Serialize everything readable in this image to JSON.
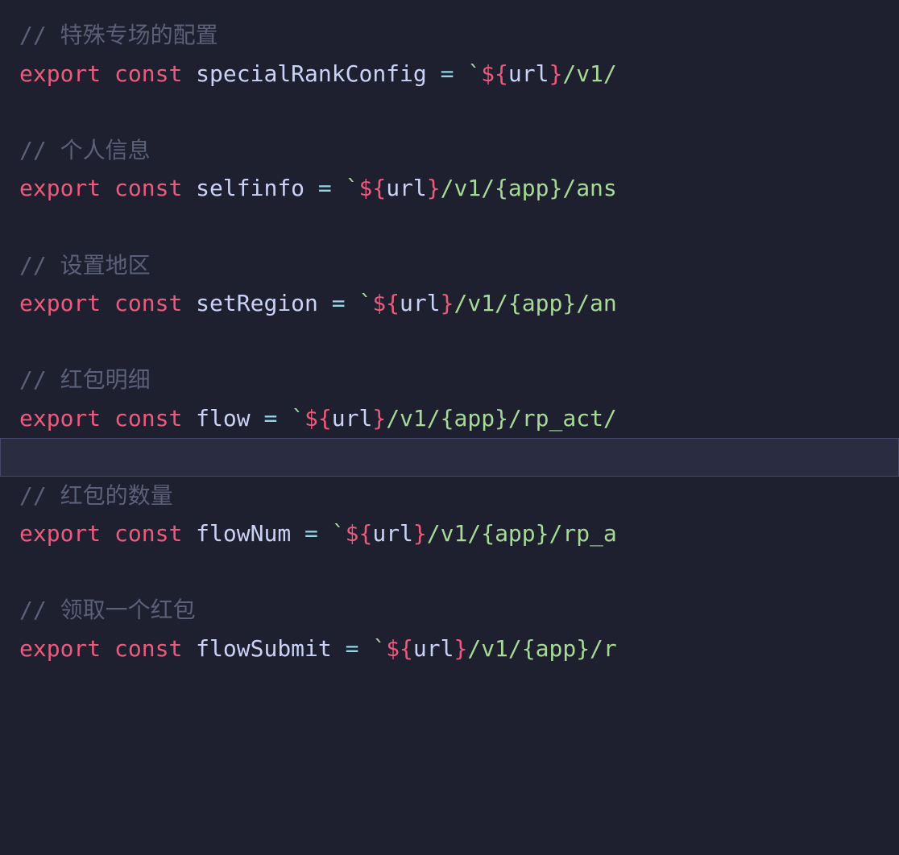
{
  "code": {
    "lines": [
      {
        "type": "comment",
        "text": "// 特殊专场的配置"
      },
      {
        "type": "declaration",
        "export": "export",
        "const": "const",
        "identifier": "specialRankConfig",
        "equals": "=",
        "backtick_open": "`",
        "template_open": "${",
        "template_var": "url",
        "template_close": "}",
        "string_tail": "/v1/"
      },
      {
        "type": "blank"
      },
      {
        "type": "comment",
        "text": "// 个人信息"
      },
      {
        "type": "declaration",
        "export": "export",
        "const": "const",
        "identifier": "selfinfo",
        "equals": "=",
        "backtick_open": "`",
        "template_open": "${",
        "template_var": "url",
        "template_close": "}",
        "string_tail": "/v1/{app}/ans"
      },
      {
        "type": "blank"
      },
      {
        "type": "comment",
        "text": "// 设置地区"
      },
      {
        "type": "declaration",
        "export": "export",
        "const": "const",
        "identifier": "setRegion",
        "equals": "=",
        "backtick_open": "`",
        "template_open": "${",
        "template_var": "url",
        "template_close": "}",
        "string_tail": "/v1/{app}/an"
      },
      {
        "type": "blank"
      },
      {
        "type": "comment",
        "text": "// 红包明细"
      },
      {
        "type": "declaration",
        "export": "export",
        "const": "const",
        "identifier": "flow",
        "equals": "=",
        "backtick_open": "`",
        "template_open": "${",
        "template_var": "url",
        "template_close": "}",
        "string_tail": "/v1/{app}/rp_act/"
      },
      {
        "type": "highlighted"
      },
      {
        "type": "comment",
        "text": "// 红包的数量"
      },
      {
        "type": "declaration",
        "export": "export",
        "const": "const",
        "identifier": "flowNum",
        "equals": "=",
        "backtick_open": "`",
        "template_open": "${",
        "template_var": "url",
        "template_close": "}",
        "string_tail": "/v1/{app}/rp_a"
      },
      {
        "type": "blank"
      },
      {
        "type": "comment",
        "text": "// 领取一个红包"
      },
      {
        "type": "declaration",
        "export": "export",
        "const": "const",
        "identifier": "flowSubmit",
        "equals": "=",
        "backtick_open": "`",
        "template_open": "${",
        "template_var": "url",
        "template_close": "}",
        "string_tail": "/v1/{app}/r"
      }
    ]
  }
}
